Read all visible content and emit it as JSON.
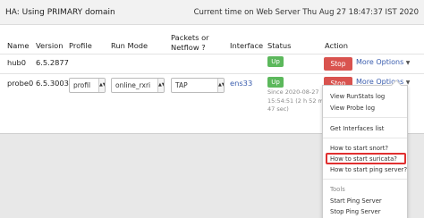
{
  "header": {
    "title": "HA: Using PRIMARY domain",
    "time": "Current time on Web Server  Thu Aug 27 18:47:37 IST 2020"
  },
  "columns": {
    "name": "Name",
    "version": "Version",
    "profile": "Profile",
    "run_mode": "Run Mode",
    "packets_line1": "Packets or",
    "packets_line2": "Netflow",
    "interface": "Interface",
    "status": "Status",
    "action": "Action"
  },
  "rows": [
    {
      "name": "hub0",
      "version": "6.5.2877",
      "status": "Up",
      "stop_label": "Stop",
      "more_label": "More Options"
    },
    {
      "name": "probe0",
      "version": "6.5.3003",
      "profile": "profil",
      "run_mode": "online_rxri",
      "packets": "TAP",
      "interface": "ens33",
      "status": "Up",
      "since_line1": "Since 2020-08-27",
      "since_line2": "15:54:51 (2 h 52 m",
      "since_line3": "47 sec)",
      "stop_label": "Stop",
      "more_label": "More Options"
    }
  ],
  "dropdown": {
    "items": [
      "View RunStats log",
      "View Probe log",
      "Get Interfaces list",
      "How to start snort?",
      "How to start suricata?",
      "How to start ping server?",
      "Start Ping Server",
      "Stop Ping Server"
    ],
    "tools_header": "Tools"
  }
}
